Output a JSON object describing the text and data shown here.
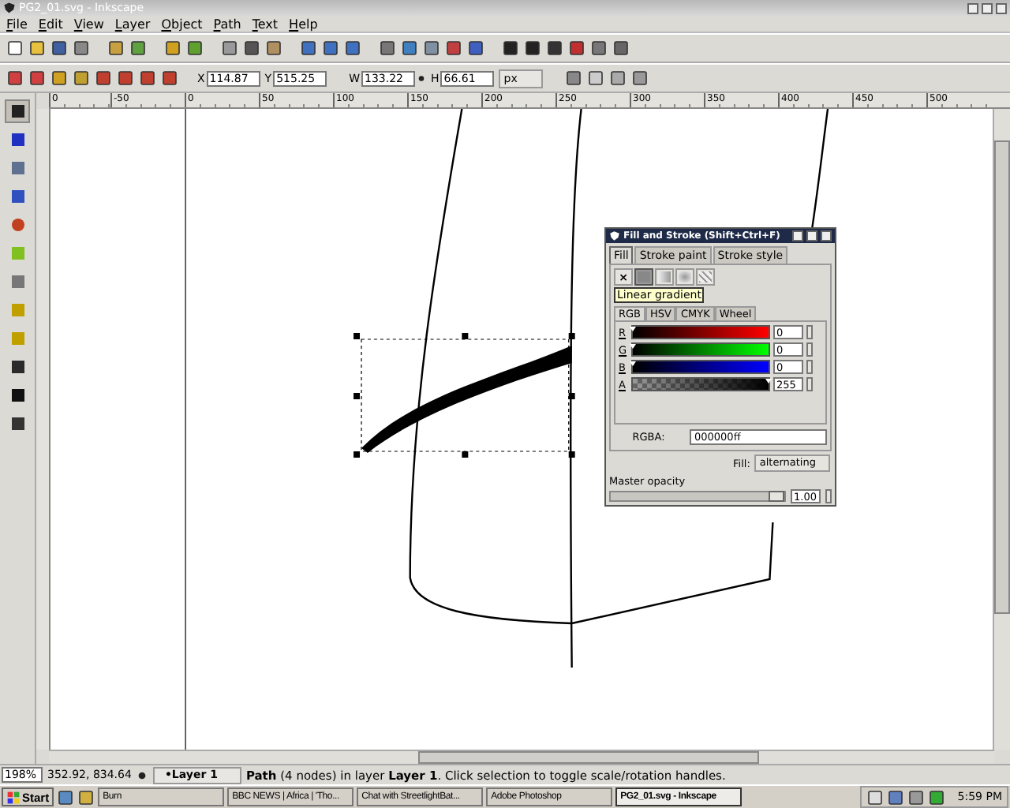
{
  "window": {
    "title": "PG2_01.svg - Inkscape"
  },
  "menu": [
    "File",
    "Edit",
    "View",
    "Layer",
    "Object",
    "Path",
    "Text",
    "Help"
  ],
  "tool_controls": {
    "fields": [
      {
        "label": "X",
        "value": "114.87"
      },
      {
        "label": "Y",
        "value": "515.25"
      },
      {
        "label": "W",
        "value": "133.22"
      },
      {
        "label": "H",
        "value": "66.61"
      }
    ],
    "unit": "px"
  },
  "ruler": {
    "labels": [
      "0",
      "-50",
      "0",
      "50",
      "100",
      "150",
      "200",
      "250",
      "300",
      "350",
      "400",
      "450",
      "500"
    ]
  },
  "toolbox": {
    "tools": [
      {
        "selected": true
      },
      {
        "selected": false
      },
      {
        "selected": false
      },
      {
        "selected": false
      },
      {
        "selected": false
      },
      {
        "selected": false
      },
      {
        "selected": false
      },
      {
        "selected": false
      },
      {
        "selected": false
      },
      {
        "selected": false
      },
      {
        "selected": false
      },
      {
        "selected": false
      }
    ]
  },
  "dialog": {
    "title": "Fill and Stroke (Shift+Ctrl+F)",
    "tabs": [
      {
        "label": "Fill",
        "selected": true
      },
      {
        "label": "Stroke paint",
        "selected": false
      },
      {
        "label": "Stroke style",
        "selected": false
      }
    ],
    "paint_modes": [
      {
        "kind": "none",
        "label": "×",
        "selected": false
      },
      {
        "kind": "flat",
        "selected": true
      },
      {
        "kind": "linear",
        "selected": false
      },
      {
        "kind": "radial",
        "selected": false
      },
      {
        "kind": "pattern",
        "selected": false
      }
    ],
    "tooltip": "Linear gradient",
    "color_tabs": [
      {
        "label": "RGB",
        "selected": true
      },
      {
        "label": "HSV",
        "selected": false
      },
      {
        "label": "CMYK",
        "selected": false
      },
      {
        "label": "Wheel",
        "selected": false
      }
    ],
    "channels": [
      {
        "label": "R",
        "kind": "red",
        "level": 0,
        "value": "0"
      },
      {
        "label": "G",
        "kind": "green",
        "level": 0,
        "value": "0"
      },
      {
        "label": "B",
        "kind": "blue",
        "level": 0,
        "value": "0"
      },
      {
        "label": "A",
        "kind": "alpha",
        "level": 1,
        "value": "255"
      }
    ],
    "rgba_label": "RGBA:",
    "rgba_value": "000000ff",
    "fill_label": "Fill:",
    "fill_rule": "alternating",
    "opacity_label": "Master opacity",
    "opacity": {
      "level": 1,
      "value": "1.00"
    }
  },
  "status_bar": {
    "zoom": "198%",
    "coords": "352.92, 834.64",
    "layer": "•Layer 1",
    "message": "**Path** (4 nodes) in layer **Layer 1**. Click selection to toggle scale/rotation handles."
  },
  "taskbar": {
    "start": "Start",
    "tasks": [
      {
        "label": "Burn",
        "selected": false
      },
      {
        "label": "BBC NEWS | Africa | 'Tho...",
        "selected": false
      },
      {
        "label": "Chat with StreetlightBat...",
        "selected": false
      },
      {
        "label": "Adobe Photoshop",
        "selected": false
      },
      {
        "label": "PG2_01.svg - Inkscape",
        "selected": true
      }
    ],
    "clock": "5:59 PM"
  }
}
